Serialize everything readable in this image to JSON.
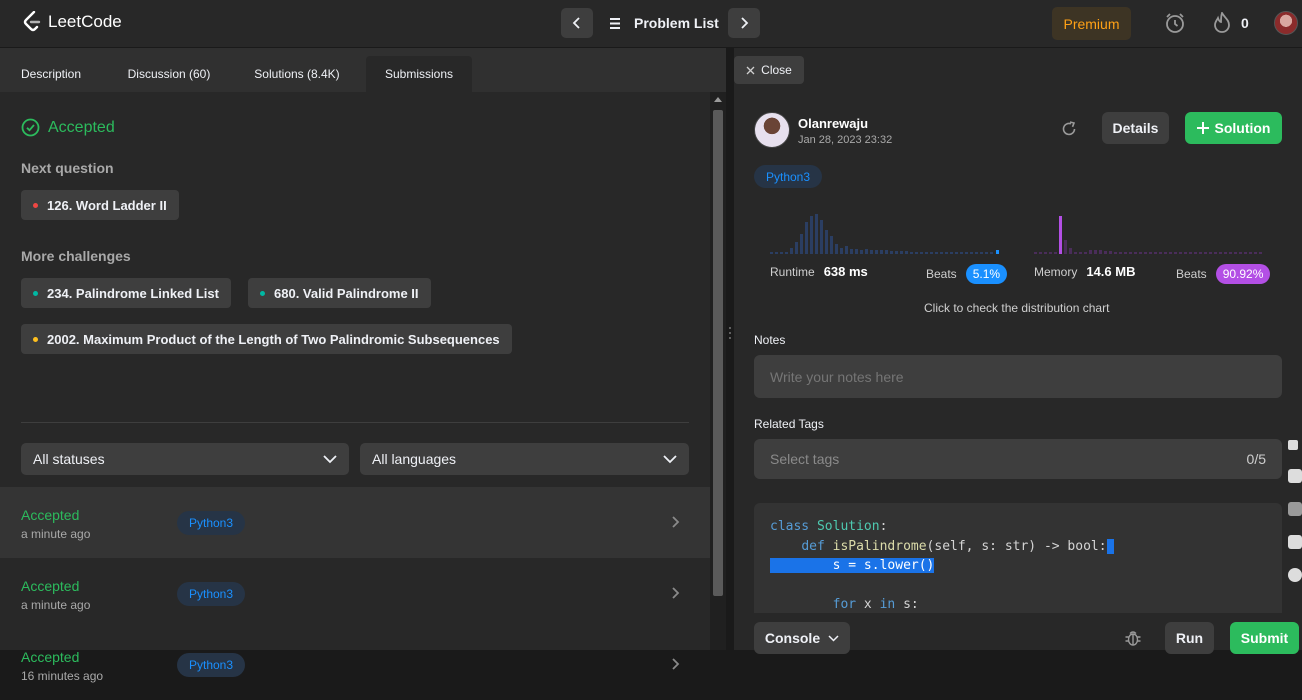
{
  "header": {
    "logo_text": "LeetCode",
    "problem_list": "Problem List",
    "premium": "Premium",
    "streak_count": "0"
  },
  "tabs": [
    "Description",
    "Discussion (60)",
    "Solutions (8.4K)",
    "Submissions"
  ],
  "result": {
    "status": "Accepted",
    "next_label": "Next question",
    "next_question": "126. Word Ladder II",
    "more_label": "More challenges",
    "challenges": [
      "234. Palindrome Linked List",
      "680. Valid Palindrome II",
      "2002. Maximum Product of the Length of Two Palindromic Subsequences"
    ]
  },
  "filters": {
    "status": "All statuses",
    "language": "All languages"
  },
  "submissions": [
    {
      "status": "Accepted",
      "time": "a minute ago",
      "lang": "Python3"
    },
    {
      "status": "Accepted",
      "time": "a minute ago",
      "lang": "Python3"
    },
    {
      "status": "Accepted",
      "time": "16 minutes ago",
      "lang": "Python3"
    }
  ],
  "detail": {
    "close": "Close",
    "user": "Olanrewaju",
    "date": "Jan 28, 2023 23:32",
    "details_btn": "Details",
    "solution_btn": "Solution",
    "lang": "Python3",
    "runtime_label": "Runtime",
    "runtime_value": "638 ms",
    "runtime_beats_label": "Beats",
    "runtime_beats": "5.1%",
    "memory_label": "Memory",
    "memory_value": "14.6 MB",
    "memory_beats_label": "Beats",
    "memory_beats": "90.92%",
    "hint": "Click to check the distribution chart",
    "notes_label": "Notes",
    "notes_placeholder": "Write your notes here",
    "tags_label": "Related Tags",
    "tags_placeholder": "Select tags",
    "tags_count": "0/5"
  },
  "code": {
    "line1_kw": "class",
    "line1_name": "Solution",
    "line1_rest": ":",
    "line2_kw": "def",
    "line2_fn": "isPalindrome",
    "line2_rest": "(self, s: str) -> bool:",
    "line3": "s = s.lower()",
    "line5_kw1": "for",
    "line5_mid": " x ",
    "line5_kw2": "in",
    "line5_rest": " s:"
  },
  "bottom": {
    "console": "Console",
    "run": "Run",
    "submit": "Submit"
  },
  "colors": {
    "accent_green": "#2cbb5d",
    "premium_orange": "#ffa116",
    "runtime_blue": "#1a90ff",
    "memory_purple": "#b34fe5"
  }
}
